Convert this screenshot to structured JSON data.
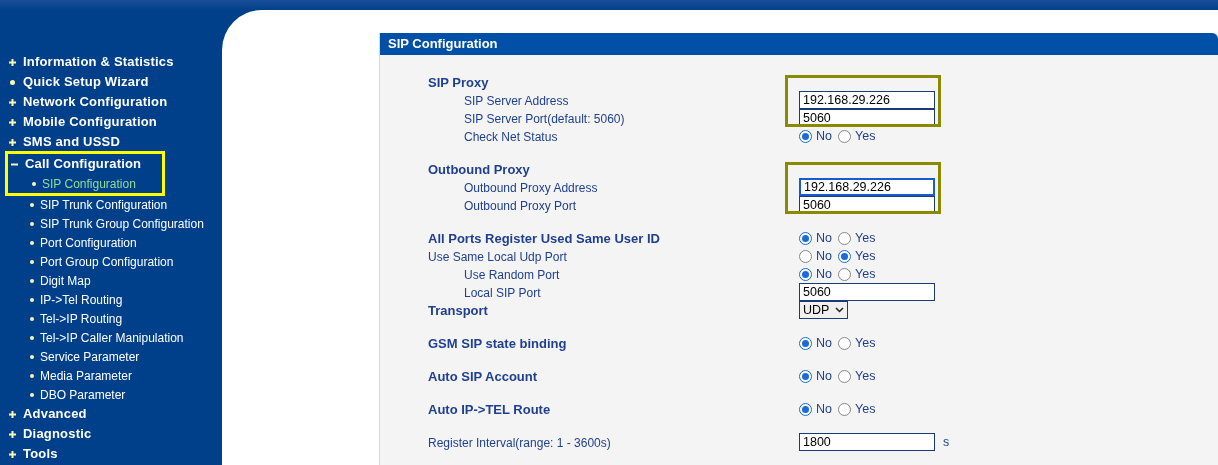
{
  "sidebar": {
    "items": [
      {
        "label": "Information & Statistics",
        "kind": "group",
        "expanded": false,
        "highlighted": false
      },
      {
        "label": "Quick Setup Wizard",
        "kind": "link",
        "highlighted": false
      },
      {
        "label": "Network Configuration",
        "kind": "group",
        "expanded": false,
        "highlighted": false
      },
      {
        "label": "Mobile Configuration",
        "kind": "group",
        "expanded": false,
        "highlighted": false
      },
      {
        "label": "SMS and USSD",
        "kind": "group",
        "expanded": false,
        "highlighted": false
      },
      {
        "label": "Call Configuration",
        "kind": "group",
        "expanded": true,
        "highlighted": true,
        "children": [
          {
            "label": "SIP Configuration",
            "selected": true
          },
          {
            "label": "SIP Trunk Configuration",
            "selected": false
          },
          {
            "label": "SIP Trunk Group Configuration",
            "selected": false
          },
          {
            "label": "Port Configuration",
            "selected": false
          },
          {
            "label": "Port Group Configuration",
            "selected": false
          },
          {
            "label": "Digit Map",
            "selected": false
          },
          {
            "label": "IP->Tel Routing",
            "selected": false
          },
          {
            "label": "Tel->IP Routing",
            "selected": false
          },
          {
            "label": "Tel->IP Caller Manipulation",
            "selected": false
          },
          {
            "label": "Service Parameter",
            "selected": false
          },
          {
            "label": "Media Parameter",
            "selected": false
          },
          {
            "label": "DBO Parameter",
            "selected": false
          }
        ]
      },
      {
        "label": "Advanced",
        "kind": "group",
        "expanded": false,
        "highlighted": false
      },
      {
        "label": "Diagnostic",
        "kind": "group",
        "expanded": false,
        "highlighted": false
      },
      {
        "label": "Tools",
        "kind": "group",
        "expanded": false,
        "highlighted": false
      }
    ]
  },
  "panel": {
    "title": "SIP Configuration",
    "sections": [
      {
        "label": "SIP Proxy",
        "bold": true,
        "kind": "heading",
        "highlighted": true,
        "children": [
          {
            "label": "SIP Server Address",
            "kind": "field",
            "value": "192.168.29.226",
            "focused": false
          },
          {
            "label": "SIP Server Port(default: 5060)",
            "kind": "field",
            "value": "5060",
            "focused": false
          },
          {
            "label": "Check Net Status",
            "kind": "radio",
            "options": [
              {
                "label": "No",
                "selected": true
              },
              {
                "label": "Yes",
                "selected": false
              }
            ]
          }
        ]
      },
      {
        "label": "Outbound Proxy",
        "bold": true,
        "kind": "heading",
        "highlighted": true,
        "children": [
          {
            "label": "Outbound Proxy Address",
            "kind": "field",
            "value": "192.168.29.226",
            "focused": true
          },
          {
            "label": "Outbound Proxy Port",
            "kind": "field",
            "value": "5060",
            "focused": false
          }
        ]
      },
      {
        "label": "All Ports Register Used Same User ID",
        "bold": true,
        "kind": "radio",
        "highlighted": false,
        "options": [
          {
            "label": "No",
            "selected": true
          },
          {
            "label": "Yes",
            "selected": false
          }
        ],
        "siblings": [
          {
            "label": "Use Same Local Udp Port",
            "bold": false,
            "kind": "radio",
            "options": [
              {
                "label": "No",
                "selected": false
              },
              {
                "label": "Yes",
                "selected": true
              }
            ],
            "children": [
              {
                "label": "Use Random Port",
                "kind": "radio",
                "options": [
                  {
                    "label": "No",
                    "selected": true
                  },
                  {
                    "label": "Yes",
                    "selected": false
                  }
                ]
              },
              {
                "label": "Local SIP Port",
                "kind": "field",
                "value": "5060",
                "focused": false
              }
            ]
          },
          {
            "label": "Transport",
            "bold": true,
            "kind": "select",
            "value": "UDP"
          }
        ]
      },
      {
        "label": "GSM SIP state binding",
        "bold": true,
        "kind": "radio",
        "highlighted": false,
        "options": [
          {
            "label": "No",
            "selected": true
          },
          {
            "label": "Yes",
            "selected": false
          }
        ]
      },
      {
        "label": "Auto SIP Account",
        "bold": true,
        "kind": "radio",
        "highlighted": false,
        "options": [
          {
            "label": "No",
            "selected": true
          },
          {
            "label": "Yes",
            "selected": false
          }
        ]
      },
      {
        "label": "Auto IP->TEL Route",
        "bold": true,
        "kind": "radio",
        "highlighted": false,
        "options": [
          {
            "label": "No",
            "selected": true
          },
          {
            "label": "Yes",
            "selected": false
          }
        ]
      },
      {
        "label": "Register Interval(range: 1 - 3600s)",
        "bold": false,
        "kind": "field",
        "value": "1800",
        "unit": "s",
        "focused": false,
        "highlighted": false
      }
    ]
  }
}
